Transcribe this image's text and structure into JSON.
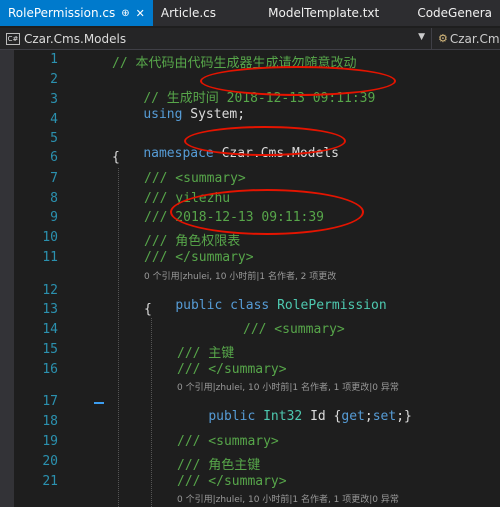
{
  "tabs": [
    {
      "label": "RolePermission.cs",
      "active": true
    },
    {
      "label": "Article.cs"
    },
    {
      "label": "ModelTemplate.txt"
    },
    {
      "label": "CodeGenera"
    }
  ],
  "tab_pin_glyph": "⊕",
  "tab_close_glyph": "✕",
  "navbar": {
    "project": "Czar.Cms.Models",
    "class_path": "Czar.Cms.M",
    "cs_icon": "C#"
  },
  "editor": {
    "line_numbers": [
      "1",
      "2",
      "3",
      "4",
      "5",
      "6",
      "7",
      "8",
      "9",
      "10",
      "11",
      "12",
      "13",
      "14",
      "15",
      "16",
      "17",
      "18",
      "19",
      "20",
      "21"
    ],
    "lines": {
      "l1": "// 本代码由代码生成器生成请勿随意改动",
      "l2a": "// 生成时间",
      "l2b": " 2018-12-13 09:11:39",
      "l3a": "using",
      "l3b": " System;",
      "l5a": "namespace",
      "l5b": " Czar.Cms.Models",
      "l6": "{",
      "l7": "/// <summary>",
      "l8": "/// yilezhu",
      "l9": "/// 2018-12-13 09:11:39",
      "l10": "/// 角色权限表",
      "l11": "/// </summary>",
      "l12a": "public",
      "l12b": "class",
      "l12c": "RolePermission",
      "l13": "{",
      "l14": "/// <summary>",
      "l15": "/// 主键",
      "l16": "/// </summary>",
      "l17a": "public",
      "l17b": "Int32",
      "l17c": " Id {",
      "l17d": "get",
      "l17e": ";",
      "l17f": "set",
      "l17g": ";}",
      "l19": "/// <summary>",
      "l20": "/// 角色主键",
      "l21": "/// </summary>"
    },
    "codelens": {
      "class_ref": "0 个引用|zhulei, 10 小时前|1 名作者, 2 项更改",
      "id_ref": "0 个引用|zhulei, 10 小时前|1 名作者, 1 项更改|0 异常",
      "rid_ref": "0 个引用|zhulei, 10 小时前|1 名作者, 1 项更改|0 异常"
    }
  }
}
